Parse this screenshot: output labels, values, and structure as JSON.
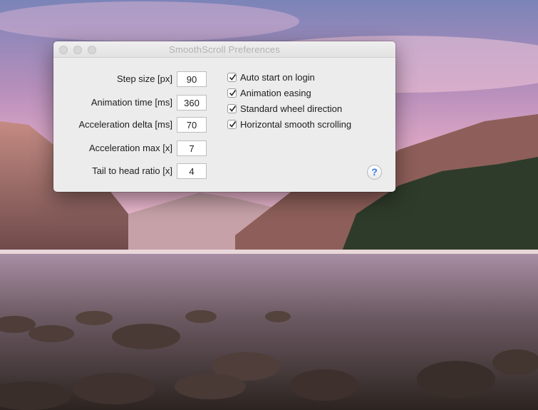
{
  "window": {
    "title": "SmoothScroll Preferences"
  },
  "fields": [
    {
      "label": "Step size [px]",
      "value": "90"
    },
    {
      "label": "Animation time [ms]",
      "value": "360"
    },
    {
      "label": "Acceleration delta [ms]",
      "value": "70"
    },
    {
      "label": "Acceleration max [x]",
      "value": "7"
    },
    {
      "label": "Tail to head ratio [x]",
      "value": "4"
    }
  ],
  "checkboxes": [
    {
      "label": "Auto start on login",
      "checked": true
    },
    {
      "label": "Animation easing",
      "checked": true
    },
    {
      "label": "Standard wheel direction",
      "checked": true
    },
    {
      "label": "Horizontal smooth scrolling",
      "checked": true
    }
  ],
  "help": {
    "glyph": "?",
    "icon": "help-icon",
    "color": "#2f7be8"
  },
  "colors": {
    "window_bg": "#ececec",
    "title_text": "#b2b2b2"
  }
}
